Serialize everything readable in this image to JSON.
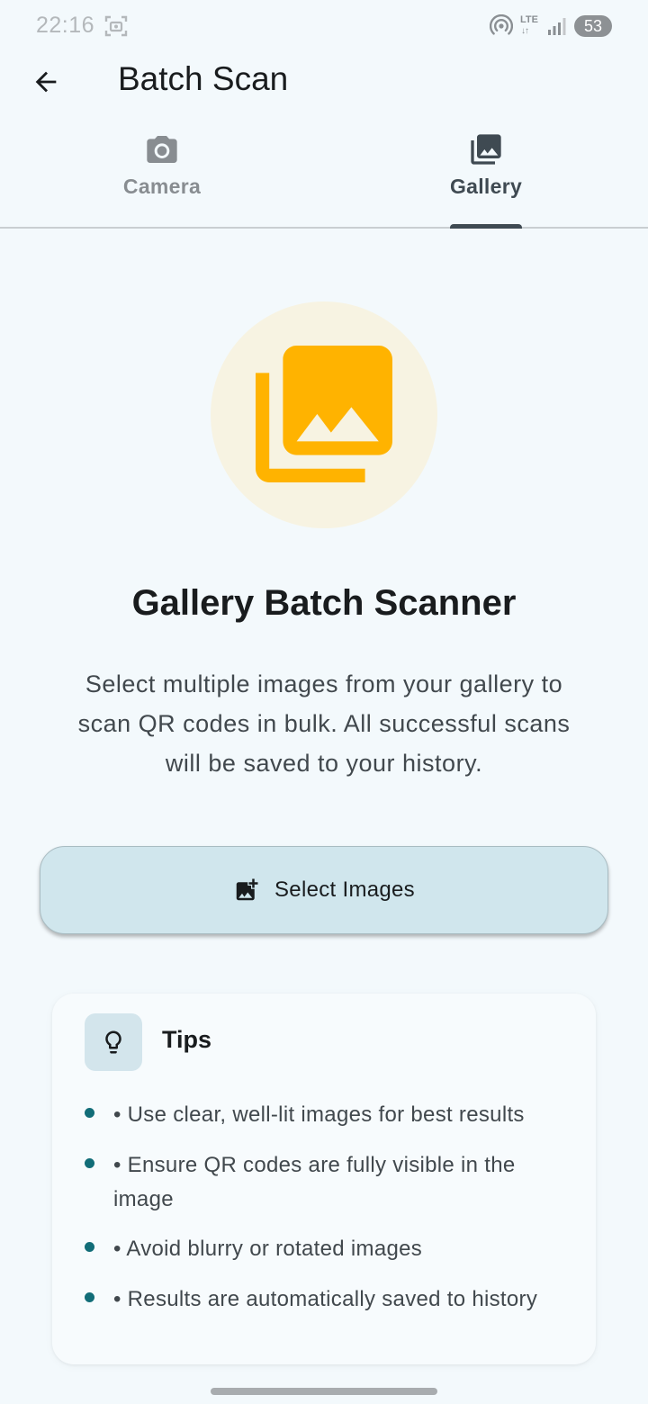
{
  "status_bar": {
    "time": "22:16",
    "network_type": "LTE",
    "network_arrows": "↓↑",
    "battery_level": "53",
    "icons": [
      "screenshot-scan-icon",
      "hotspot-icon",
      "signal-icon"
    ]
  },
  "app_bar": {
    "title": "Batch Scan",
    "back_icon": "arrow-back-icon"
  },
  "tabs": [
    {
      "label": "Camera",
      "icon": "camera-icon",
      "selected": false
    },
    {
      "label": "Gallery",
      "icon": "photo-library-icon",
      "selected": true
    }
  ],
  "hero": {
    "icon": "photo-library-icon",
    "icon_color": "#ffb300",
    "circle_color": "#f7f3e2",
    "title": "Gallery Batch Scanner",
    "description": "Select multiple images from your gallery to scan QR codes in bulk. All successful scans will be saved to your history."
  },
  "select_button": {
    "label": "Select Images",
    "icon": "add-photo-icon"
  },
  "tips": {
    "title": "Tips",
    "icon": "lightbulb-icon",
    "items": [
      "• Use clear, well-lit images for best results",
      "• Ensure QR codes are fully visible in the image",
      "• Avoid blurry or rotated images",
      "• Results are automatically saved to history"
    ]
  },
  "colors": {
    "background": "#f3f9fc",
    "accent": "#126d78",
    "button_fill": "#d0e6ed"
  }
}
